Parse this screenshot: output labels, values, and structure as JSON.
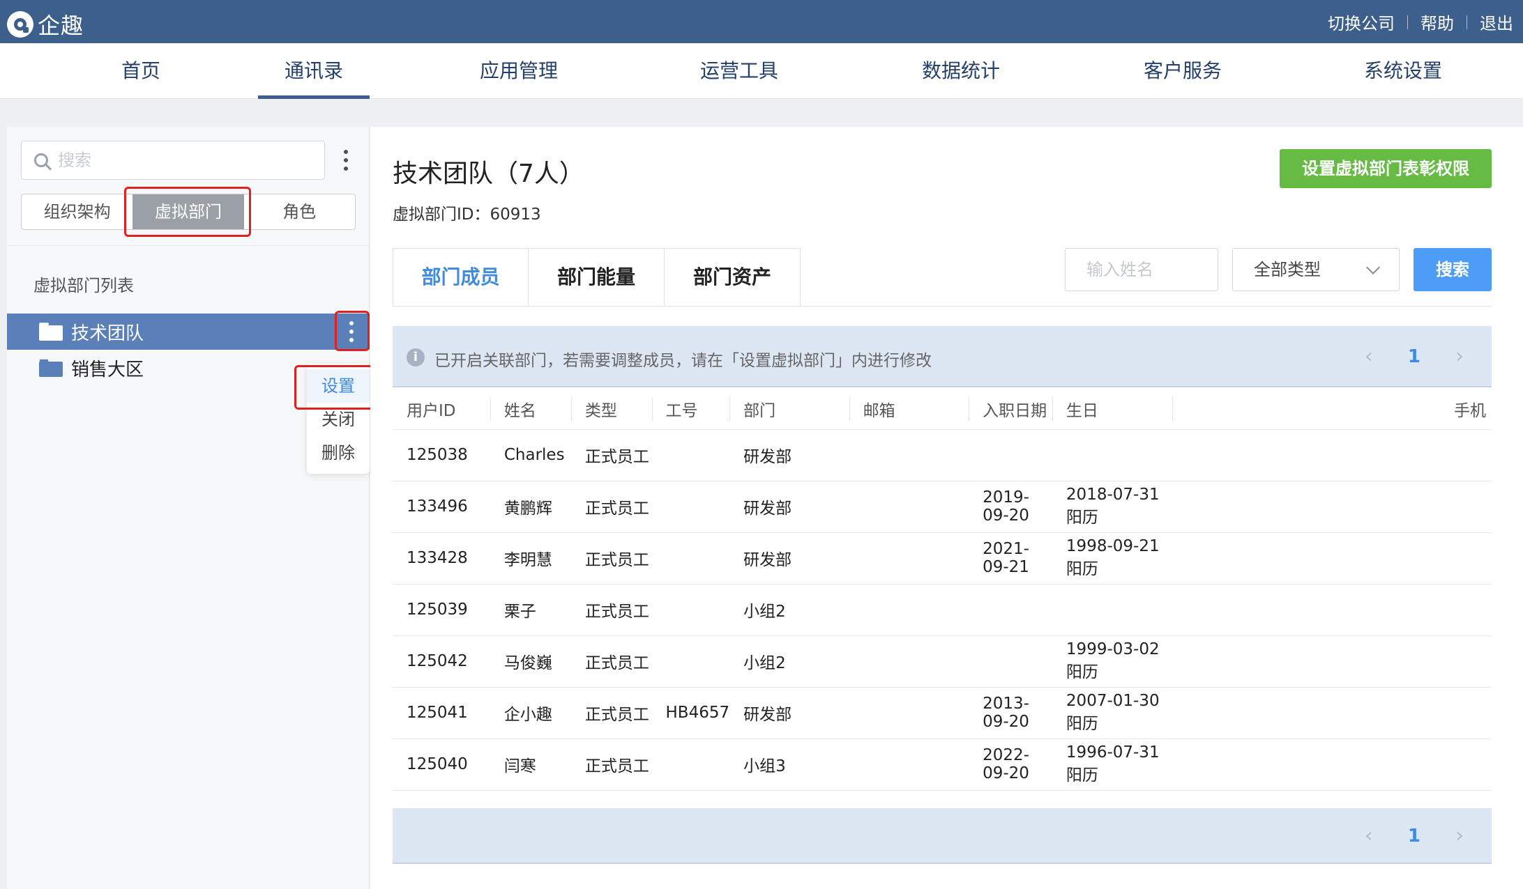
{
  "app": {
    "brand": "企趣"
  },
  "top_actions": {
    "switch_company": "切换公司",
    "help": "帮助",
    "logout": "退出"
  },
  "nav": {
    "home": "首页",
    "contacts": "通讯录",
    "apps": "应用管理",
    "ops": "运营工具",
    "stats": "数据统计",
    "service": "客户服务",
    "settings": "系统设置"
  },
  "left": {
    "search_placeholder": "搜索",
    "seg_org": "组织架构",
    "seg_virtual": "虚拟部门",
    "seg_role": "角色",
    "list_title": "虚拟部门列表",
    "departments": [
      {
        "name": "技术团队"
      },
      {
        "name": "销售大区"
      }
    ],
    "menu": {
      "settings": "设置",
      "close": "关闭",
      "delete": "删除"
    }
  },
  "main": {
    "title": "技术团队（7人）",
    "subtitle": "虚拟部门ID：60913",
    "btn_permission": "设置虚拟部门表彰权限",
    "tabs": {
      "members": "部门成员",
      "energy": "部门能量",
      "assets": "部门资产"
    },
    "name_placeholder": "输入姓名",
    "type_select": "全部类型",
    "search_btn": "搜索",
    "info": "已开启关联部门，若需要调整成员，请在「设置虚拟部门」内进行修改",
    "page": "1",
    "prev": "‹",
    "next": "›",
    "columns": [
      "用户ID",
      "姓名",
      "类型",
      "工号",
      "部门",
      "邮箱",
      "入职日期",
      "生日",
      "手机"
    ],
    "rows": [
      {
        "id": "125038",
        "name": "Charles",
        "type": "正式员工",
        "no": "",
        "dept": "研发部",
        "email": "",
        "join": "",
        "birthday": "",
        "phone": ""
      },
      {
        "id": "133496",
        "name": "黄鹏辉",
        "type": "正式员工",
        "no": "",
        "dept": "研发部",
        "email": "",
        "join": "2019-09-20",
        "birthday": "2018-07-31阳历",
        "phone": ""
      },
      {
        "id": "133428",
        "name": "李明慧",
        "type": "正式员工",
        "no": "",
        "dept": "研发部",
        "email": "",
        "join": "2021-09-21",
        "birthday": "1998-09-21阳历",
        "phone": ""
      },
      {
        "id": "125039",
        "name": "栗子",
        "type": "正式员工",
        "no": "",
        "dept": "小组2",
        "email": "",
        "join": "",
        "birthday": "",
        "phone": ""
      },
      {
        "id": "125042",
        "name": "马俊巍",
        "type": "正式员工",
        "no": "",
        "dept": "小组2",
        "email": "",
        "join": "",
        "birthday": "1999-03-02阳历",
        "phone": ""
      },
      {
        "id": "125041",
        "name": "企小趣",
        "type": "正式员工",
        "no": "HB4657",
        "dept": "研发部",
        "email": "",
        "join": "2013-09-20",
        "birthday": "2007-01-30阳历",
        "phone": ""
      },
      {
        "id": "125040",
        "name": "闫寒",
        "type": "正式员工",
        "no": "",
        "dept": "小组3",
        "email": "",
        "join": "2022-09-20",
        "birthday": "1996-07-31阳历",
        "phone": ""
      }
    ]
  }
}
